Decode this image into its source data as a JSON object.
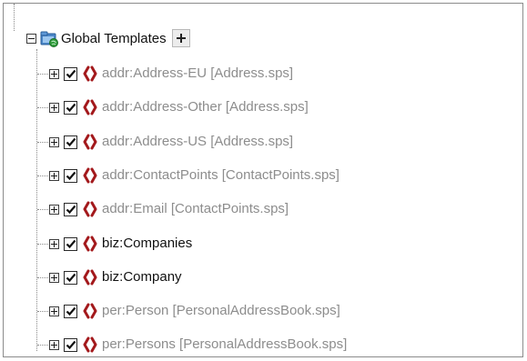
{
  "root": {
    "label": "Global Templates",
    "expander": "minus",
    "icon": "global-templates-folder-icon",
    "add_button_icon": "plus-icon"
  },
  "items": [
    {
      "label": "addr:Address-EU [Address.sps]",
      "color": "#8d8d8d",
      "checked": true
    },
    {
      "label": "addr:Address-Other [Address.sps]",
      "color": "#8d8d8d",
      "checked": true
    },
    {
      "label": "addr:Address-US [Address.sps]",
      "color": "#8d8d8d",
      "checked": true
    },
    {
      "label": "addr:ContactPoints [ContactPoints.sps]",
      "color": "#8d8d8d",
      "checked": true
    },
    {
      "label": "addr:Email [ContactPoints.sps]",
      "color": "#8d8d8d",
      "checked": true
    },
    {
      "label": "biz:Companies",
      "color": "#111111",
      "checked": true
    },
    {
      "label": "biz:Company",
      "color": "#111111",
      "checked": true
    },
    {
      "label": "per:Person [PersonalAddressBook.sps]",
      "color": "#8d8d8d",
      "checked": true
    },
    {
      "label": "per:Persons [PersonalAddressBook.sps]",
      "color": "#8d8d8d",
      "checked": true
    }
  ],
  "colors": {
    "brace_red": "#a3191c",
    "check_black": "#111111",
    "folder_blue": "#4a86c8",
    "globe_green": "#2e9b3a"
  }
}
